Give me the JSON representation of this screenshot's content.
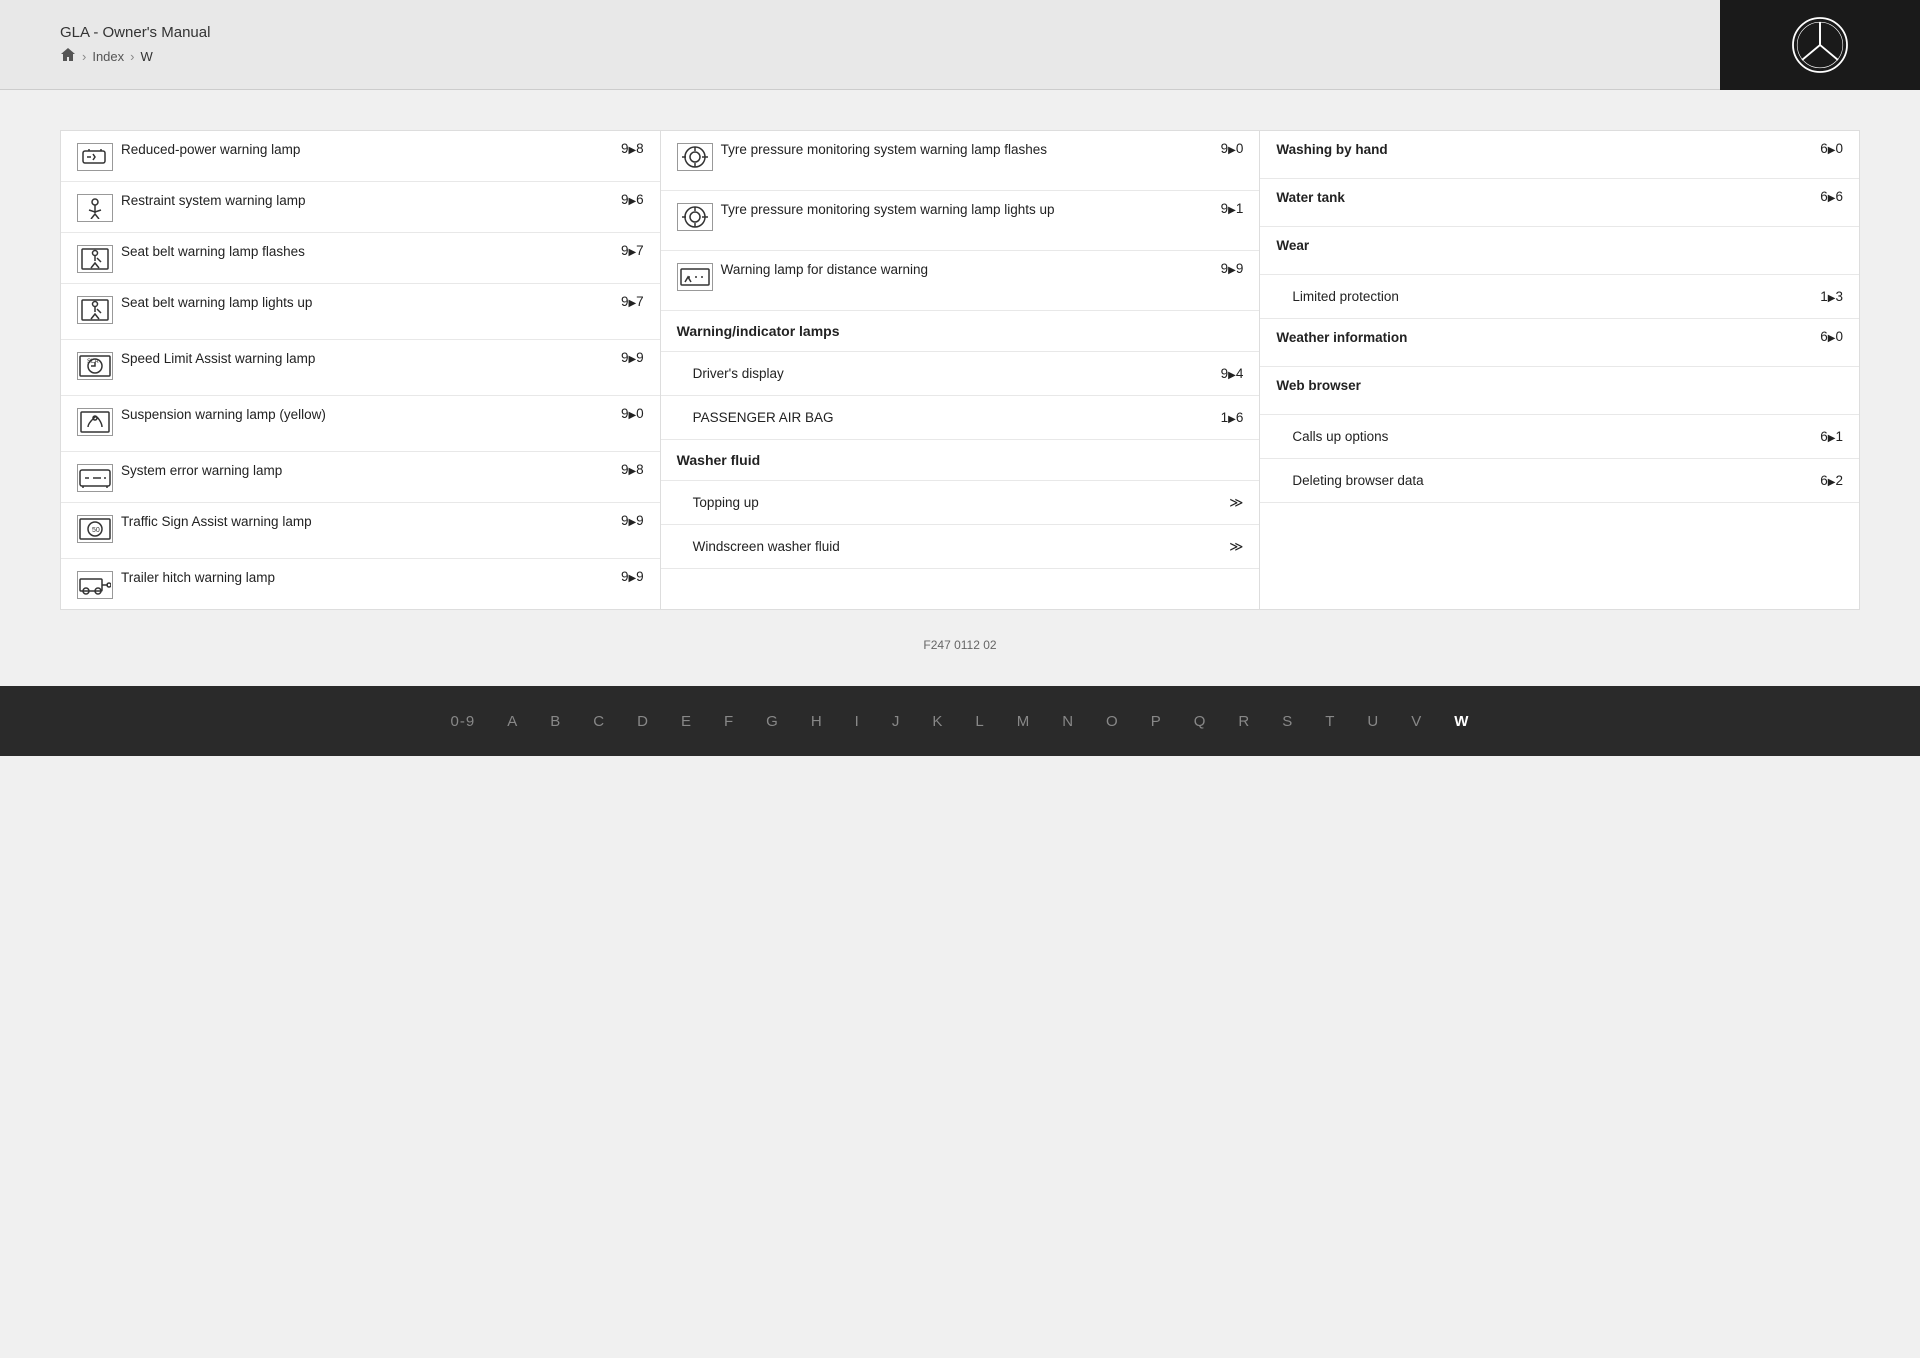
{
  "header": {
    "title": "GLA - Owner's Manual",
    "breadcrumb": {
      "home": "🏠",
      "index": "Index",
      "current": "W"
    }
  },
  "columns": {
    "col1": {
      "entries": [
        {
          "icon": "car-warning",
          "text": "Reduced-power warning lamp",
          "page": "9▶8",
          "hasIcon": true
        },
        {
          "icon": "person-warning",
          "text": "Restraint system warning lamp",
          "page": "9▶6",
          "hasIcon": true
        },
        {
          "icon": "belt-flash",
          "text": "Seat belt warning lamp flashes",
          "page": "9▶7",
          "hasIcon": true
        },
        {
          "icon": "belt-light",
          "text": "Seat belt warning lamp lights up",
          "page": "9▶7",
          "hasIcon": true
        },
        {
          "icon": "speed-limit",
          "text": "Speed Limit Assist warning lamp",
          "page": "9▶9",
          "hasIcon": true
        },
        {
          "icon": "suspension",
          "text": "Suspension warning lamp (yellow)",
          "page": "9▶0",
          "hasIcon": true
        },
        {
          "icon": "sys-error",
          "text": "System error warning lamp",
          "page": "9▶8",
          "hasIcon": true
        },
        {
          "icon": "traffic-sign",
          "text": "Traffic Sign Assist warning lamp",
          "page": "9▶9",
          "hasIcon": true
        },
        {
          "icon": "trailer",
          "text": "Trailer hitch warning lamp",
          "page": "9▶9",
          "hasIcon": true
        }
      ]
    },
    "col2": {
      "sections": [
        {
          "type": "entry",
          "icon": "tyre-pressure",
          "text": "Tyre pressure monitoring system warning lamp flashes",
          "page": "9▶0",
          "hasIcon": true
        },
        {
          "type": "entry",
          "icon": "tyre-pressure2",
          "text": "Tyre pressure monitoring system warning lamp lights up",
          "page": "9▶1",
          "hasIcon": true
        },
        {
          "type": "entry",
          "icon": "distance-warn",
          "text": "Warning lamp for distance warning",
          "page": "9▶9",
          "hasIcon": true
        },
        {
          "type": "section-header",
          "text": "Warning/indicator lamps"
        },
        {
          "type": "sub-entry",
          "text": "Driver's display",
          "page": "9▶4"
        },
        {
          "type": "sub-entry",
          "text": "PASSENGER AIR BAG",
          "page": "1▶6"
        },
        {
          "type": "section-header",
          "text": "Washer fluid"
        },
        {
          "type": "sub-entry",
          "text": "Topping up",
          "page": "≫"
        },
        {
          "type": "sub-entry",
          "text": "Windscreen washer fluid",
          "page": "≫"
        }
      ]
    },
    "col3": {
      "sections": [
        {
          "type": "bold-entry",
          "text": "Washing by hand",
          "page": "6▶0"
        },
        {
          "type": "bold-entry",
          "text": "Water tank",
          "page": "6▶6"
        },
        {
          "type": "bold-entry",
          "text": "Wear",
          "page": ""
        },
        {
          "type": "sub-entry",
          "text": "Limited protection",
          "page": "1▶3"
        },
        {
          "type": "bold-entry",
          "text": "Weather information",
          "page": "6▶0"
        },
        {
          "type": "bold-entry",
          "text": "Web browser",
          "page": ""
        },
        {
          "type": "sub-entry",
          "text": "Calls up options",
          "page": "6▶1"
        },
        {
          "type": "sub-entry",
          "text": "Deleting browser data",
          "page": "6▶2"
        }
      ]
    }
  },
  "footer": {
    "doc_id": "F247 0112 02",
    "alphabet": [
      "0-9",
      "A",
      "B",
      "C",
      "D",
      "E",
      "F",
      "G",
      "H",
      "I",
      "J",
      "K",
      "L",
      "M",
      "N",
      "O",
      "P",
      "Q",
      "R",
      "S",
      "T",
      "U",
      "V",
      "W"
    ],
    "active": "W"
  }
}
